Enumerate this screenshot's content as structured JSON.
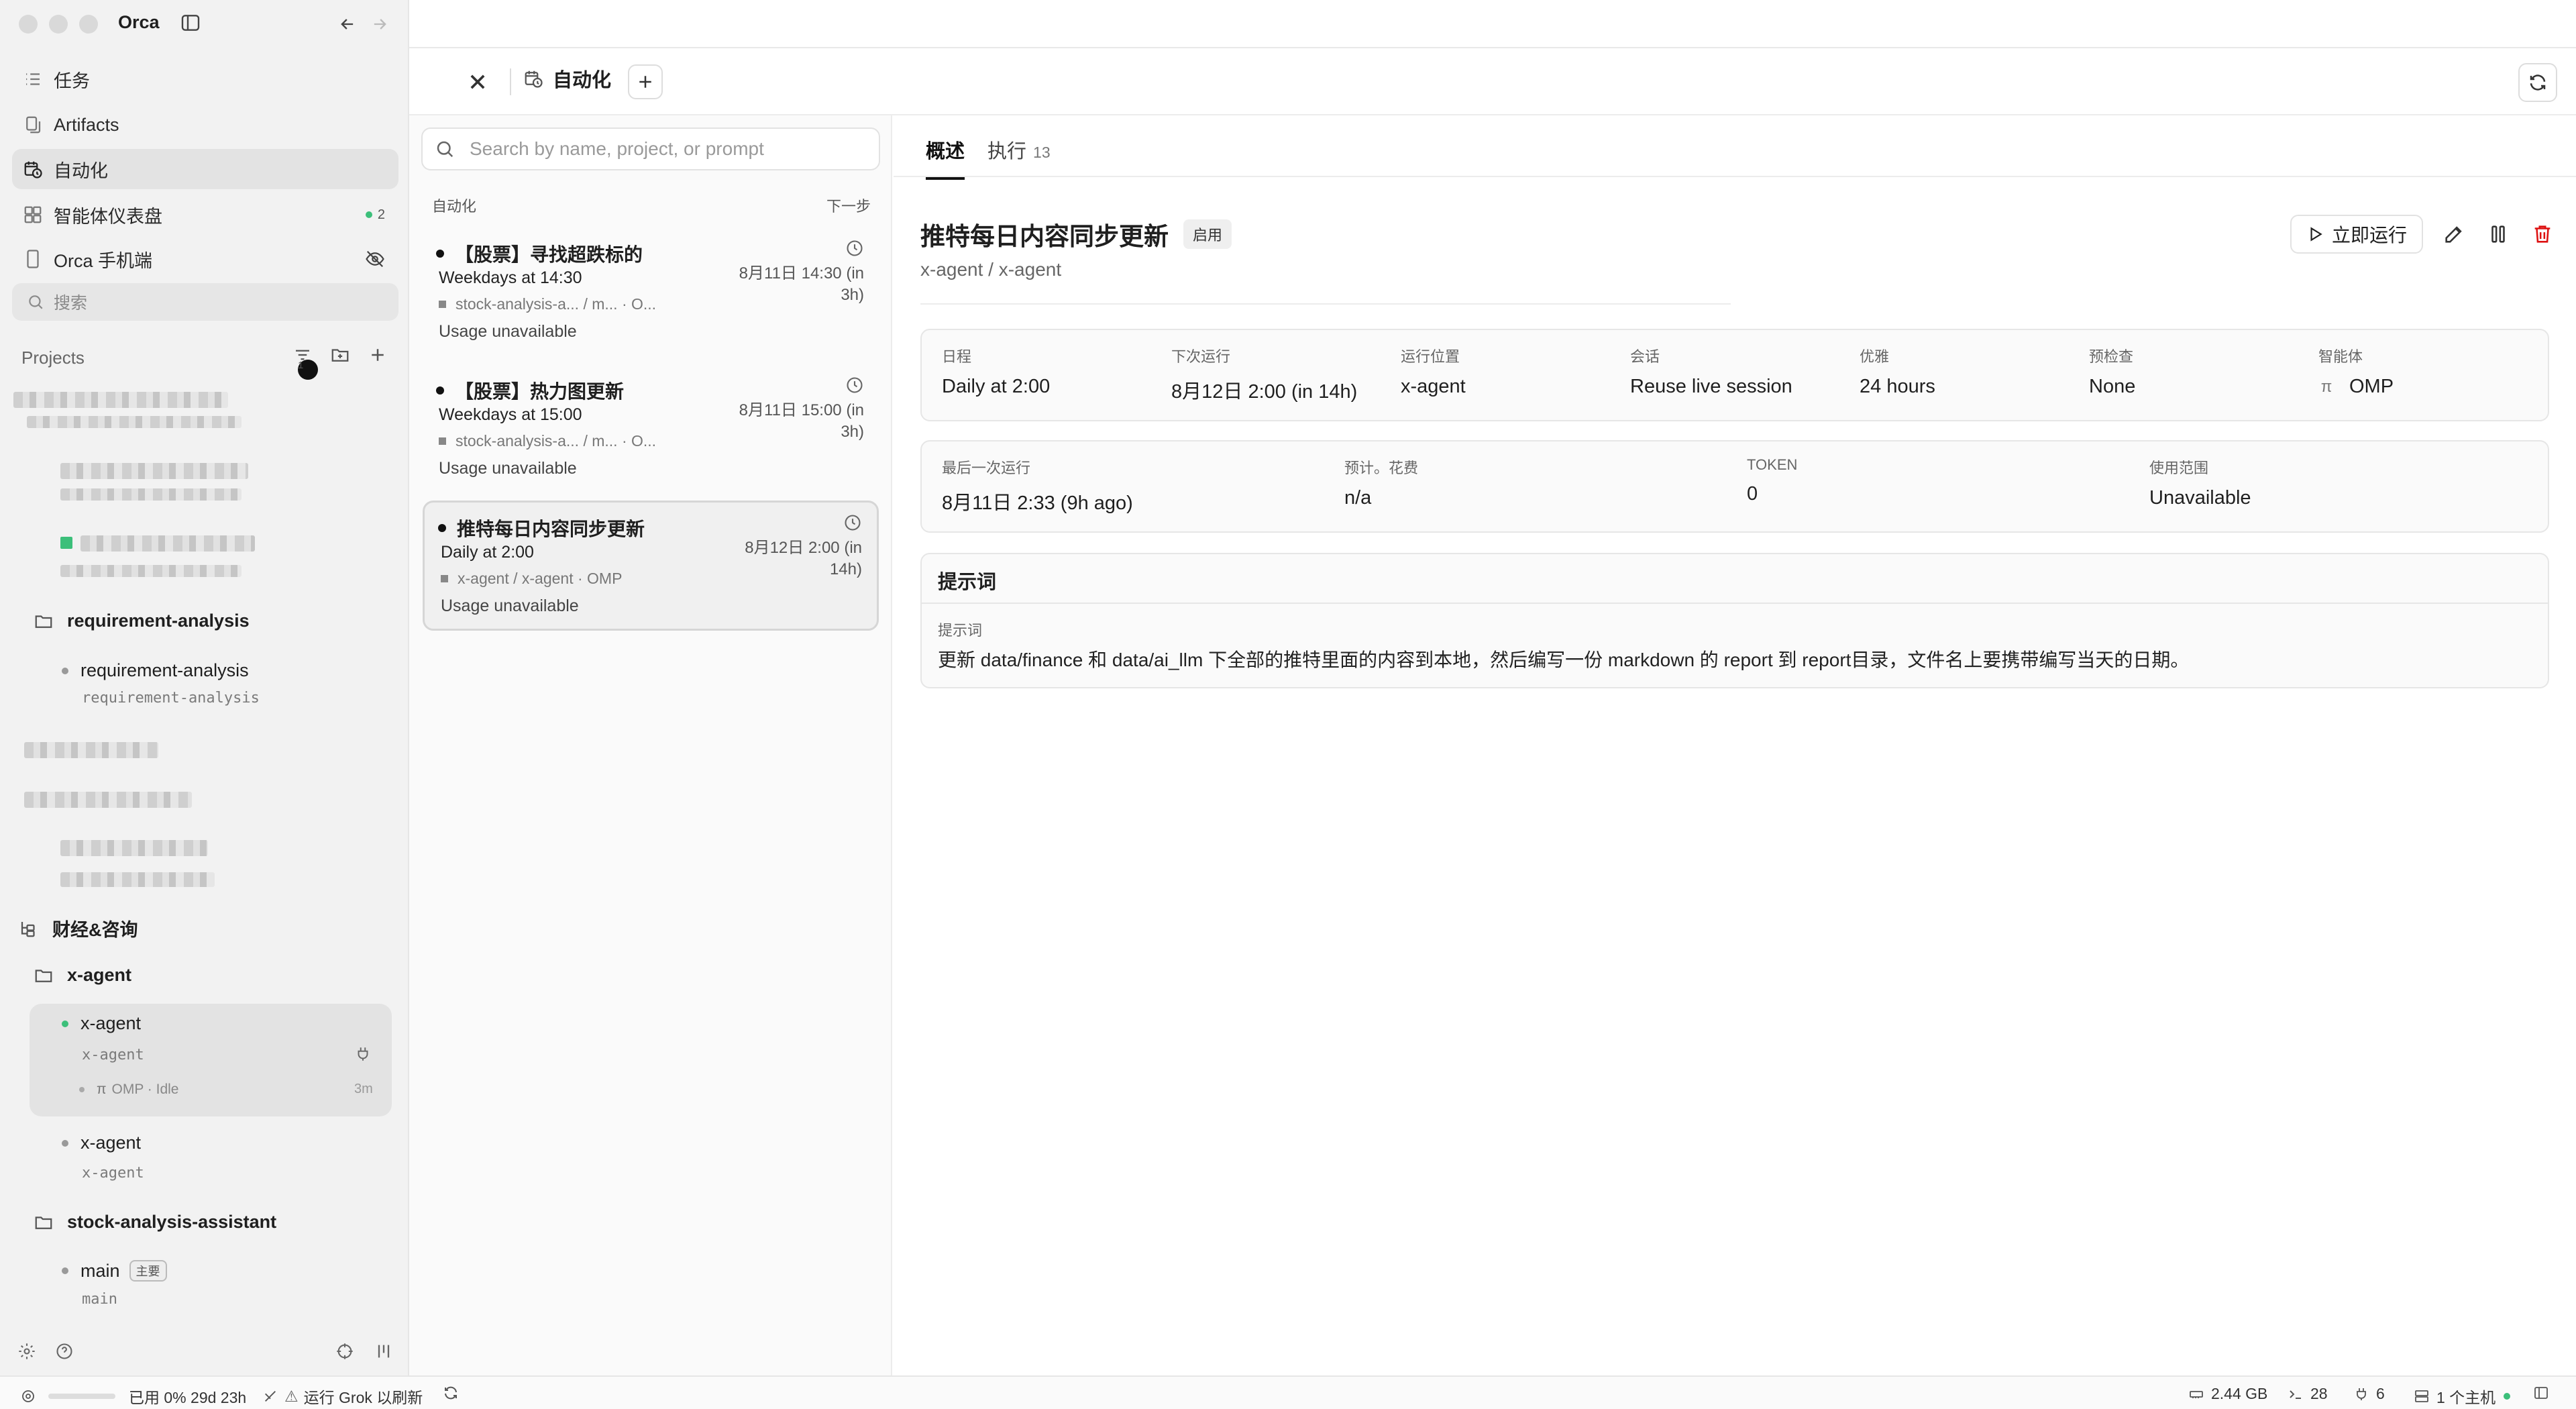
{
  "app": {
    "name": "Orca"
  },
  "nav": [
    {
      "label": "任务",
      "icon": "list-icon"
    },
    {
      "label": "Artifacts",
      "icon": "artifacts-icon"
    },
    {
      "label": "自动化",
      "icon": "calendar-clock-icon"
    },
    {
      "label": "智能体仪表盘",
      "icon": "dashboard-icon",
      "badge": "2"
    },
    {
      "label": "Orca 手机端",
      "icon": "phone-icon"
    }
  ],
  "sidebar_search": {
    "placeholder": "搜索"
  },
  "projects": {
    "header": "Projects",
    "filter_badge": "1",
    "groups": [
      {
        "name": "requirement-analysis",
        "worktrees": [
          {
            "title": "requirement-analysis",
            "sub": "requirement-analysis"
          }
        ]
      },
      {
        "name": "财经&咨询"
      },
      {
        "name": "x-agent",
        "worktrees": [
          {
            "title": "x-agent",
            "sub": "x-agent",
            "session": "OMP · Idle",
            "session_time": "3m"
          },
          {
            "title": "x-agent",
            "sub": "x-agent"
          }
        ]
      },
      {
        "name": "stock-analysis-assistant",
        "worktrees": [
          {
            "title": "main",
            "tag": "主要",
            "sub": "main"
          }
        ]
      }
    ]
  },
  "tabbar": {
    "tab_label": "自动化"
  },
  "list": {
    "search_placeholder": "Search by name, project, or prompt",
    "header_left": "自动化",
    "header_right": "下一步",
    "items": [
      {
        "title": "【股票】寻找超跌标的",
        "schedule": "Weekdays at 14:30",
        "meta": "stock-analysis-a...  /  m...  · O...",
        "usage": "Usage unavailable",
        "next": "8月11日 14:30 (in 3h)"
      },
      {
        "title": "【股票】热力图更新",
        "schedule": "Weekdays at 15:00",
        "meta": "stock-analysis-a...  /  m...  · O...",
        "usage": "Usage unavailable",
        "next": "8月11日 15:00 (in 3h)"
      },
      {
        "title": "推特每日内容同步更新",
        "schedule": "Daily at 2:00",
        "meta": "x-agent  /  x-agent  · OMP",
        "usage": "Usage unavailable",
        "next": "8月12日 2:00 (in 14h)"
      }
    ]
  },
  "detail": {
    "tabs": [
      {
        "label": "概述"
      },
      {
        "label": "执行",
        "count": "13"
      }
    ],
    "title": "推特每日内容同步更新",
    "status": "启用",
    "path": "x-agent / x-agent",
    "run_now": "立即运行",
    "row1": [
      {
        "label": "日程",
        "value": "Daily at 2:00"
      },
      {
        "label": "下次运行",
        "value": "8月12日 2:00 (in 14h)"
      },
      {
        "label": "运行位置",
        "value": "x-agent"
      },
      {
        "label": "会话",
        "value": "Reuse live session"
      },
      {
        "label": "优雅",
        "value": "24 hours"
      },
      {
        "label": "预检查",
        "value": "None"
      },
      {
        "label": "智能体",
        "value": "OMP"
      }
    ],
    "row2": [
      {
        "label": "最后一次运行",
        "value": "8月11日 2:33 (9h ago)"
      },
      {
        "label": "预计。花费",
        "value": "n/a"
      },
      {
        "label": "TOKEN",
        "value": "0"
      },
      {
        "label": "使用范围",
        "value": "Unavailable"
      }
    ],
    "prompt": {
      "header": "提示词",
      "label": "提示词",
      "text": "更新 data/finance 和 data/ai_llm 下全部的推特里面的内容到本地，然后编写一份 markdown 的 report 到 report目录，文件名上要携带编写当天的日期。"
    }
  },
  "statusbar": {
    "usage": "已用 0% 29d 23h",
    "grok": "运行 Grok 以刷新",
    "memory": "2.44 GB",
    "terminals": "28",
    "ports": "6",
    "hosts": "1 个主机"
  },
  "colors": {
    "green": "#3cbf7a",
    "red": "#dd1111",
    "sidebar_bg": "#f2f2f2"
  }
}
